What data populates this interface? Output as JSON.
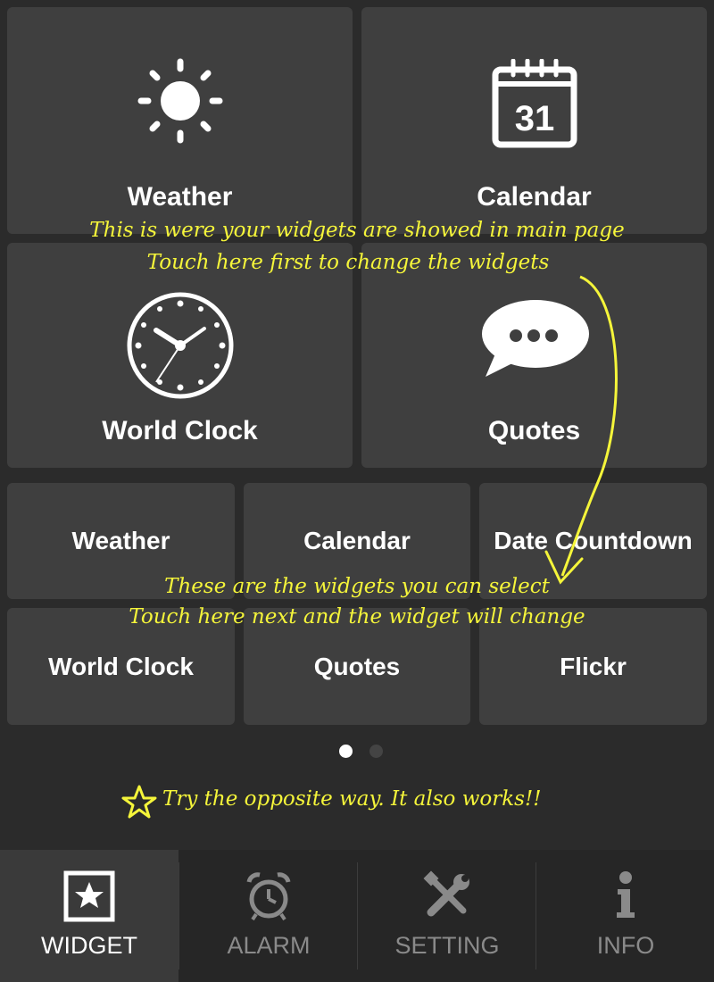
{
  "main_widgets": [
    {
      "label": "Weather",
      "icon": "sun-icon"
    },
    {
      "label": "Calendar",
      "icon": "calendar-icon",
      "calendar_day": "31"
    },
    {
      "label": "World Clock",
      "icon": "clock-icon"
    },
    {
      "label": "Quotes",
      "icon": "speech-bubble-icon"
    }
  ],
  "selectable_widgets": [
    {
      "label": "Weather"
    },
    {
      "label": "Calendar"
    },
    {
      "label": "Date Countdown"
    },
    {
      "label": "World Clock"
    },
    {
      "label": "Quotes"
    },
    {
      "label": "Flickr"
    }
  ],
  "annotations": {
    "main_line1": "This is were your widgets are showed in main page",
    "main_line2": "Touch here first to change the  widgets",
    "select_line1": "These are the widgets you can select",
    "select_line2": "Touch here next and the widget will change",
    "tip": "Try the opposite way. It also works!!"
  },
  "pager": {
    "active_page": 1,
    "total_pages": 2
  },
  "bottom_nav": [
    {
      "label": "WIDGET",
      "icon": "star-box-icon",
      "active": true
    },
    {
      "label": "ALARM",
      "icon": "alarm-clock-icon",
      "active": false
    },
    {
      "label": "SETTING",
      "icon": "wrench-screwdriver-icon",
      "active": false
    },
    {
      "label": "INFO",
      "icon": "info-icon",
      "active": false
    }
  ],
  "colors": {
    "background": "#2b2b2b",
    "tile": "#3f3f3f",
    "annotation": "#f5f53a",
    "nav_active": "#ffffff",
    "nav_inactive": "#8a8a8a"
  }
}
